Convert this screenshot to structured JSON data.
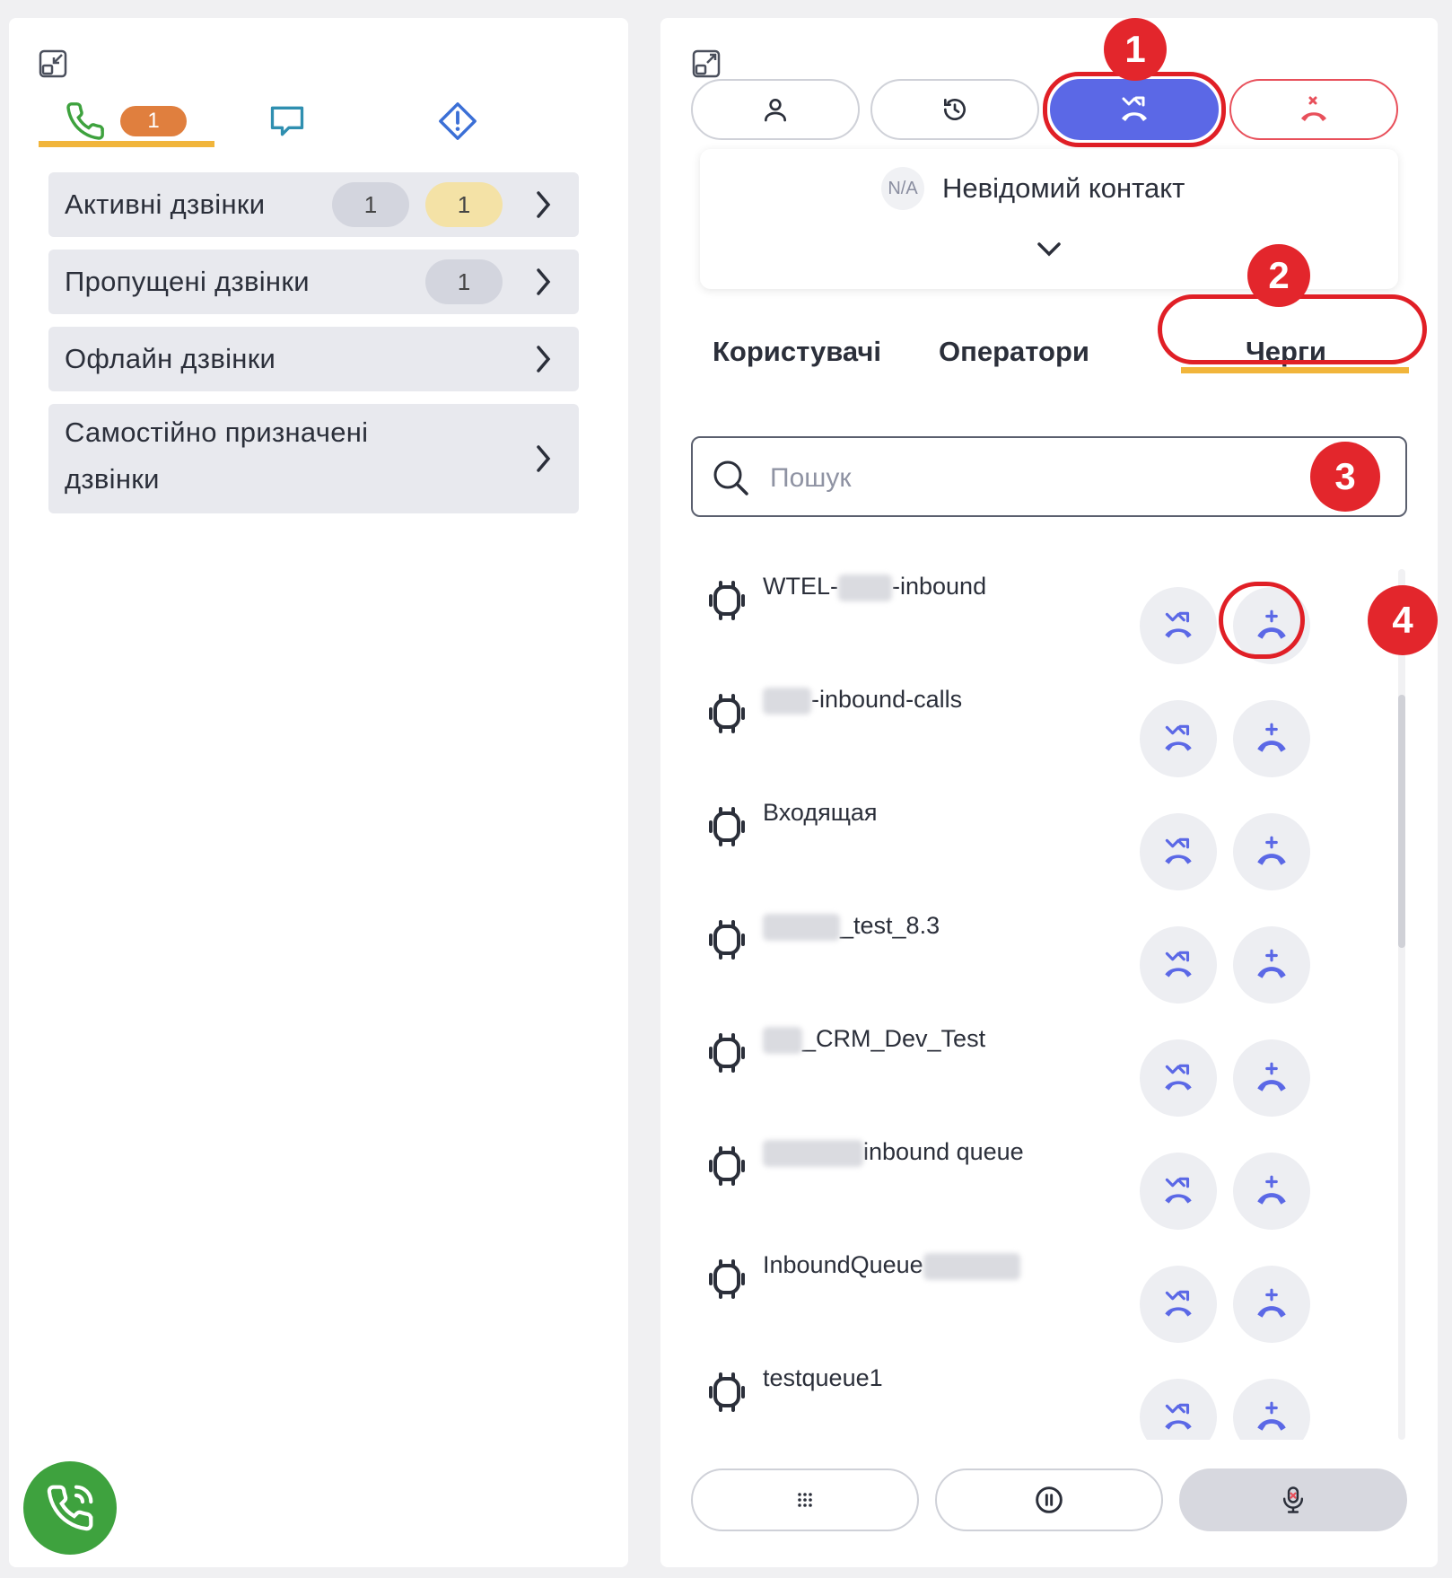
{
  "left": {
    "tabs": [
      {
        "name": "calls",
        "icon": "phone-icon",
        "badge": "1"
      },
      {
        "name": "chats",
        "icon": "chat-icon"
      },
      {
        "name": "alerts",
        "icon": "alert-diamond-icon"
      }
    ],
    "rows": [
      {
        "label": "Активні дзвінки",
        "counts": [
          "1",
          "1"
        ]
      },
      {
        "label": "Пропущені дзвінки",
        "counts": [
          "1"
        ]
      },
      {
        "label": "Офлайн дзвінки"
      },
      {
        "label_line1": "Самостійно призначені",
        "label_line2": "дзвінки"
      }
    ]
  },
  "right": {
    "top_buttons": [
      "user-icon",
      "history-icon",
      "transfer-call-icon",
      "hangup-icon"
    ],
    "contact": {
      "avatar": "N/A",
      "name": "Невідомий контакт"
    },
    "tabs": [
      "Користувачі",
      "Оператори",
      "Черги"
    ],
    "active_tab": "Черги",
    "search": {
      "placeholder": "Пошук",
      "value": ""
    },
    "queues": [
      {
        "prefix": "WTEL-",
        "suffix": "-inbound",
        "blur_w": 60
      },
      {
        "prefix": "",
        "suffix": "-inbound-calls",
        "blur_w": 54
      },
      {
        "prefix": "Входящая",
        "suffix": "",
        "blur_w": 0
      },
      {
        "prefix": "",
        "suffix": "_test_8.3",
        "blur_w": 86
      },
      {
        "prefix": "",
        "suffix": "_CRM_Dev_Test",
        "blur_w": 44
      },
      {
        "prefix": "",
        "suffix": "inbound queue",
        "blur_w": 112
      },
      {
        "prefix": "InboundQueue",
        "suffix": "",
        "blur_w": 108
      },
      {
        "prefix": "testqueue1",
        "suffix": "",
        "blur_w": 0
      }
    ],
    "bottom_buttons": [
      "dialpad-icon",
      "pause-icon",
      "mic-icon"
    ]
  },
  "markers": [
    "1",
    "2",
    "3",
    "4"
  ],
  "colors": {
    "accent": "#5b68e6",
    "green": "#3ea23e",
    "orange": "#e07f3e",
    "tab_underline": "#f1b53b",
    "marker": "#e3262c"
  }
}
